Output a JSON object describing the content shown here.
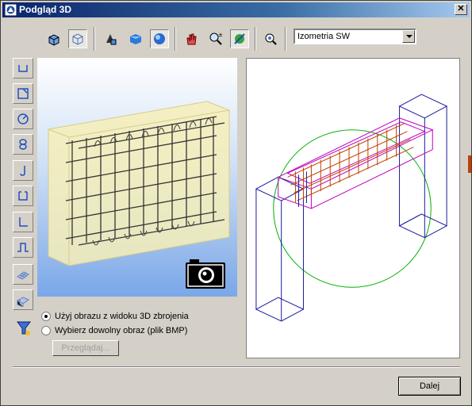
{
  "window": {
    "title": "Podgląd 3D",
    "close_icon": "close-icon"
  },
  "toolbar": {
    "buttons": [
      {
        "name": "open-cube-icon"
      },
      {
        "name": "wireframe-cube-icon",
        "pressed": true
      },
      {
        "name": "render-settings-icon"
      },
      {
        "name": "solid-cube-icon"
      },
      {
        "name": "sphere-icon",
        "pressed": true
      },
      {
        "name": "pan-hand-icon"
      },
      {
        "name": "zoom-icon"
      },
      {
        "name": "rotate-icon",
        "pressed": true
      },
      {
        "name": "zoom-extents-icon"
      }
    ],
    "view_select": {
      "value": "Izometria SW"
    }
  },
  "sidebar": {
    "shapes": [
      "hook-u-icon",
      "square-stirrup-icon",
      "circle-stirrup-icon",
      "spiral-icon",
      "j-hook-icon",
      "open-stirrup-icon",
      "l-bar-icon",
      "wave-bar-icon",
      "mesh-icon",
      "mesh-3d-icon"
    ]
  },
  "options": {
    "use_3d_image": "Użyj obrazu z widoku 3D zbrojenia",
    "choose_image": "Wybierz dowolny obraz (plik BMP)",
    "browse": "Przeglądaj..."
  },
  "footer": {
    "next": "Dalej"
  },
  "colors": {
    "title_gradient_start": "#0a246a",
    "view_wire": "#1a1aa0",
    "view_circle": "#00b000",
    "view_beam": "#c000c0",
    "rebar": "#c04000"
  }
}
